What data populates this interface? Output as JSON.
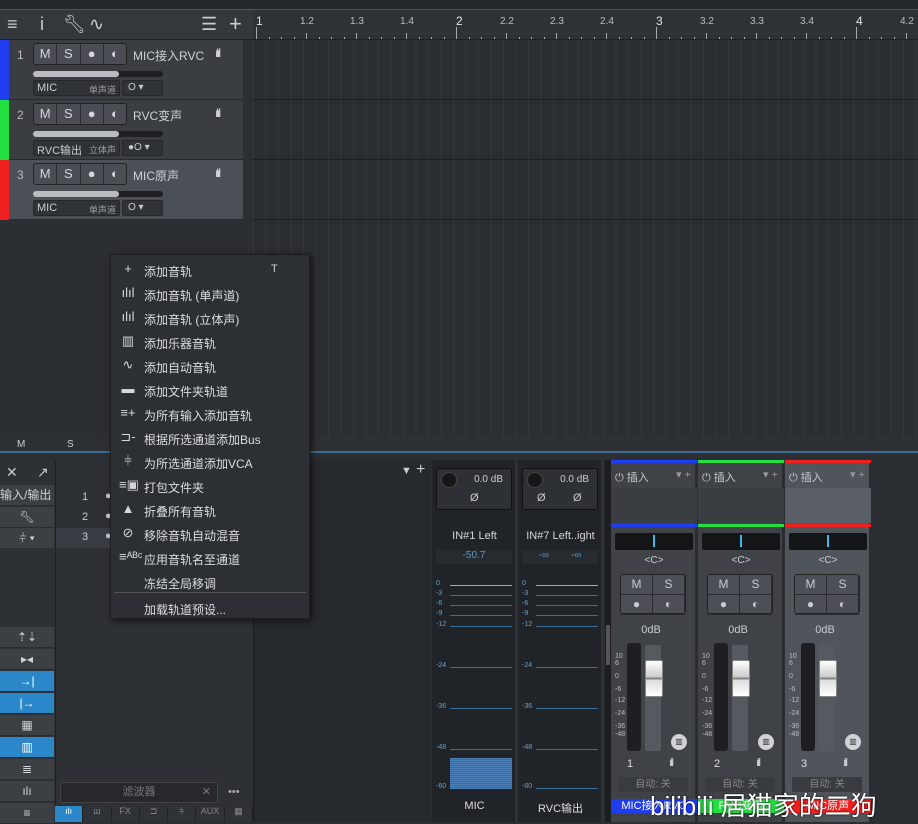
{
  "toolbar": {
    "icons": [
      "list-icon",
      "info-icon",
      "wrench-icon",
      "automation-icon",
      "track-list-icon",
      "add-icon"
    ]
  },
  "ruler": {
    "labels": [
      "1",
      "1.2",
      "1.3",
      "1.4",
      "2",
      "2.2",
      "2.3",
      "2.4",
      "3",
      "3.2",
      "3.3",
      "3.4",
      "4",
      "4.2"
    ]
  },
  "tracks": [
    {
      "num": "1",
      "name": "MIC接入RVC",
      "m": "M",
      "s": "S",
      "input": "MIC",
      "mode": "单声道",
      "monitor": "O",
      "color": "#1e3cf0",
      "volume": 0.66
    },
    {
      "num": "2",
      "name": "RVC变声",
      "m": "M",
      "s": "S",
      "input": "RVC输出",
      "mode": "立体声",
      "monitor": "●O",
      "color": "#22e040",
      "volume": 0.66
    },
    {
      "num": "3",
      "name": "MIC原声",
      "m": "M",
      "s": "S",
      "input": "MIC",
      "mode": "单声道",
      "monitor": "O",
      "color": "#f02020",
      "volume": 0.66
    }
  ],
  "msbar": {
    "m": "M",
    "s": "S"
  },
  "menu": {
    "items": [
      {
        "icon": "+",
        "label": "添加音轨",
        "shortcut": "T"
      },
      {
        "icon": "ılıl",
        "label": "添加音轨 (单声道)"
      },
      {
        "icon": "ılıl",
        "label": "添加音轨 (立体声)"
      },
      {
        "icon": "▥",
        "label": "添加乐器音轨"
      },
      {
        "icon": "∿",
        "label": "添加自动音轨"
      },
      {
        "icon": "▬",
        "label": "添加文件夹轨道"
      },
      {
        "icon": "≡+",
        "label": "为所有输入添加音轨"
      },
      {
        "icon": "⊐-",
        "label": "根据所选通道添加Bus"
      },
      {
        "icon": "⫩",
        "label": "为所选通道添加VCA"
      },
      {
        "icon": "≡▣",
        "label": "打包文件夹"
      },
      {
        "icon": "▲",
        "label": "折叠所有音轨"
      },
      {
        "icon": "⊘",
        "label": "移除音轨自动混音"
      },
      {
        "icon": "≡ᴬᴮᶜ",
        "label": "应用音轨名至通道"
      },
      {
        "icon": "",
        "label": "冻结全局移调"
      },
      {
        "icon": "",
        "label": "加载轨道预设..."
      }
    ]
  },
  "mixer_left": {
    "close": "✕",
    "expand": "↗",
    "io_label": "输入/输出",
    "buttons": [
      "⇡⇣",
      "▸◂",
      "→|",
      "|→",
      "▦",
      "▥",
      "≣",
      "ılı",
      "≡"
    ]
  },
  "channel_list": {
    "rows": [
      "1",
      "2",
      "3"
    ],
    "filter_placeholder": "滤波器",
    "filter_clear": "✕",
    "more": "•••",
    "tabs": [
      "ılı",
      "ш",
      "FX",
      "⊐",
      "⫩",
      "AUX",
      "▦"
    ]
  },
  "input_channels": [
    {
      "gain": "0.0 dB",
      "phase": [
        "Ø"
      ],
      "name": "IN#1 Left",
      "peak": "-50.7",
      "label": "MIC",
      "level_db": -50.7
    },
    {
      "gain": "0.0 dB",
      "phase": [
        "Ø",
        "Ø"
      ],
      "name": "IN#7 Left..ight",
      "peak": "-∞",
      "peak2": "-∞",
      "label": "RVC输出"
    }
  ],
  "meter_scale": [
    "0",
    "-3",
    "-6",
    "-9",
    "-12",
    "-24",
    "-36",
    "-48",
    "-60"
  ],
  "fader_scale": [
    "10",
    "6",
    "0",
    "-6",
    "-12",
    "-24",
    "-36",
    "-48"
  ],
  "channels": [
    {
      "insert": "插入",
      "pan": "<C>",
      "m": "M",
      "s": "S",
      "db": "0dB",
      "num": "1",
      "auto": "自动: 关",
      "name": "MIC接入RVC",
      "color": "#1e3cf0"
    },
    {
      "insert": "插入",
      "pan": "<C>",
      "m": "M",
      "s": "S",
      "db": "0dB",
      "num": "2",
      "auto": "自动: 关",
      "name": "RVC变声",
      "color": "#22e040"
    },
    {
      "insert": "插入",
      "pan": "<C>",
      "m": "M",
      "s": "S",
      "db": "0dB",
      "num": "3",
      "auto": "自动: 关",
      "name": "MIC原声",
      "color": "#f02020"
    }
  ],
  "watermark": "bilibili 居猫家的二狗"
}
